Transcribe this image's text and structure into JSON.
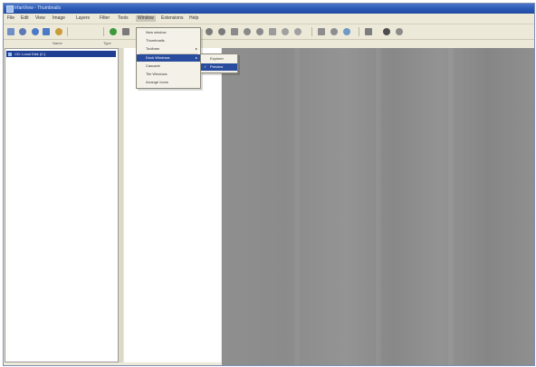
{
  "window": {
    "title": "IrfanView - Thumbnails"
  },
  "menubar": {
    "items": [
      {
        "label": "File",
        "active": false
      },
      {
        "label": "Edit",
        "active": false
      },
      {
        "label": "View",
        "active": false
      },
      {
        "label": "Image",
        "active": false
      },
      {
        "label": "Layers",
        "active": false
      },
      {
        "label": "Filter",
        "active": false
      },
      {
        "label": "Tools",
        "active": false
      },
      {
        "label": "Window",
        "active": true
      },
      {
        "label": "Extensions",
        "active": false
      },
      {
        "label": "Help",
        "active": false
      }
    ]
  },
  "toolbar": {
    "buttons": [
      {
        "icon": "new-file-icon",
        "color": "#6f8fc7"
      },
      {
        "icon": "open-icon",
        "color": "#5f79b6"
      },
      {
        "icon": "back-icon",
        "color": "#4b7ac8"
      },
      {
        "icon": "forward-icon",
        "color": "#4b7ac8"
      },
      {
        "icon": "refresh-icon",
        "color": "#ca9b3a"
      },
      {
        "icon": "green-app-icon",
        "color": "#3c9a3c"
      },
      {
        "icon": "tools-icon",
        "color": "#7a7a7a"
      },
      {
        "icon": "pen-icon",
        "color": "#8a8a5a"
      },
      {
        "icon": "paint-icon",
        "color": "#3b9c63"
      },
      {
        "icon": "globe-icon",
        "color": "#3e8ad6"
      },
      {
        "icon": "brush-icon",
        "color": "#7c7c7c"
      },
      {
        "icon": "crop-icon",
        "color": "#7b7b7b"
      },
      {
        "icon": "zoom-in-icon",
        "color": "#8a8a8a"
      },
      {
        "icon": "zoom-out-icon",
        "color": "#8a8a8a"
      },
      {
        "icon": "rotate-icon",
        "color": "#8a8a8a"
      },
      {
        "icon": "flip-icon",
        "color": "#9b9b9b"
      },
      {
        "icon": "gray-icon-1",
        "color": "#a0a0a0"
      },
      {
        "icon": "gray-icon-2",
        "color": "#a0a0a0"
      },
      {
        "icon": "arrows-icon",
        "color": "#8d8d8d"
      },
      {
        "icon": "dots-icon",
        "color": "#8d8d8d"
      },
      {
        "icon": "pin-icon",
        "color": "#6e9ac6"
      },
      {
        "icon": "grid-icon",
        "color": "#7d7d7d"
      },
      {
        "icon": "dropdown-icon",
        "color": "#4e4e4e"
      },
      {
        "icon": "next-icon",
        "color": "#8c8c8c"
      }
    ]
  },
  "panel_headers": {
    "left": "Name",
    "middle": "Type"
  },
  "tree": {
    "selected_row": "CD: Local Disk (C:)"
  },
  "dropdown": {
    "items": [
      {
        "label": "New window",
        "highlighted": false,
        "has_submenu": false
      },
      {
        "label": "Thumbnails",
        "highlighted": false,
        "has_submenu": false
      },
      {
        "label": "Toolbars",
        "highlighted": false,
        "has_submenu": true
      },
      {
        "label": "Dock Windows",
        "highlighted": true,
        "has_submenu": true
      },
      {
        "label": "Cascade",
        "highlighted": false,
        "has_submenu": false
      },
      {
        "label": "Tile Windows",
        "highlighted": false,
        "has_submenu": false
      },
      {
        "label": "Arrange Icons",
        "highlighted": false,
        "has_submenu": false
      }
    ]
  },
  "submenu": {
    "items": [
      {
        "label": "Explorer",
        "highlighted": false,
        "checked": false
      },
      {
        "label": "Preview",
        "highlighted": true,
        "checked": true
      }
    ]
  },
  "colors": {
    "title_bar": "#2c5bb5",
    "selection": "#1f3f93",
    "canvas_gray": "#8f8f8f"
  }
}
